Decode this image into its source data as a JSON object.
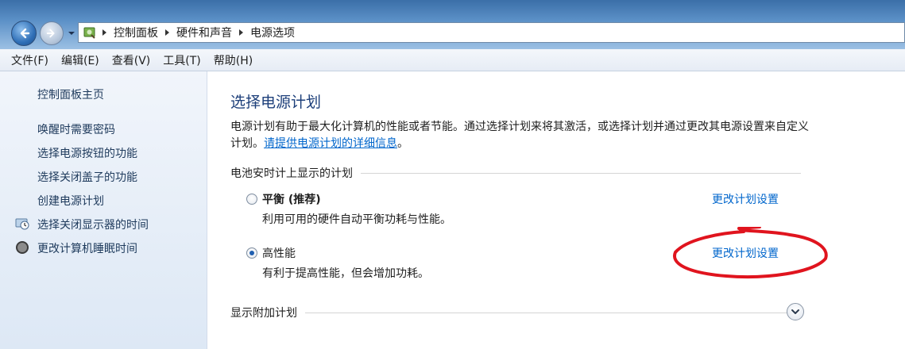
{
  "address": {
    "breadcrumbs": [
      "控制面板",
      "硬件和声音",
      "电源选项"
    ]
  },
  "menu": {
    "items": [
      "文件(F)",
      "编辑(E)",
      "查看(V)",
      "工具(T)",
      "帮助(H)"
    ]
  },
  "sidebar": {
    "home": "控制面板主页",
    "links": [
      "唤醒时需要密码",
      "选择电源按钮的功能",
      "选择关闭盖子的功能",
      "创建电源计划",
      "选择关闭显示器的时间",
      "更改计算机睡眠时间"
    ]
  },
  "main": {
    "title": "选择电源计划",
    "description": "电源计划有助于最大化计算机的性能或者节能。通过选择计划来将其激活，或选择计划并通过更改其电源设置来自定义计划。",
    "description_link": "请提供电源计划的详细信息",
    "description_end": "。",
    "section_label": "电池安时计上显示的计划",
    "plans": [
      {
        "name": "平衡 (推荐)",
        "desc": "利用可用的硬件自动平衡功耗与性能。",
        "link": "更改计划设置",
        "selected": false
      },
      {
        "name": "高性能",
        "desc": "有利于提高性能，但会增加功耗。",
        "link": "更改计划设置",
        "selected": true
      }
    ],
    "more_plans": "显示附加计划"
  },
  "colors": {
    "link": "#0066cc",
    "title": "#1d3f7a",
    "annotation": "#e0141e"
  }
}
